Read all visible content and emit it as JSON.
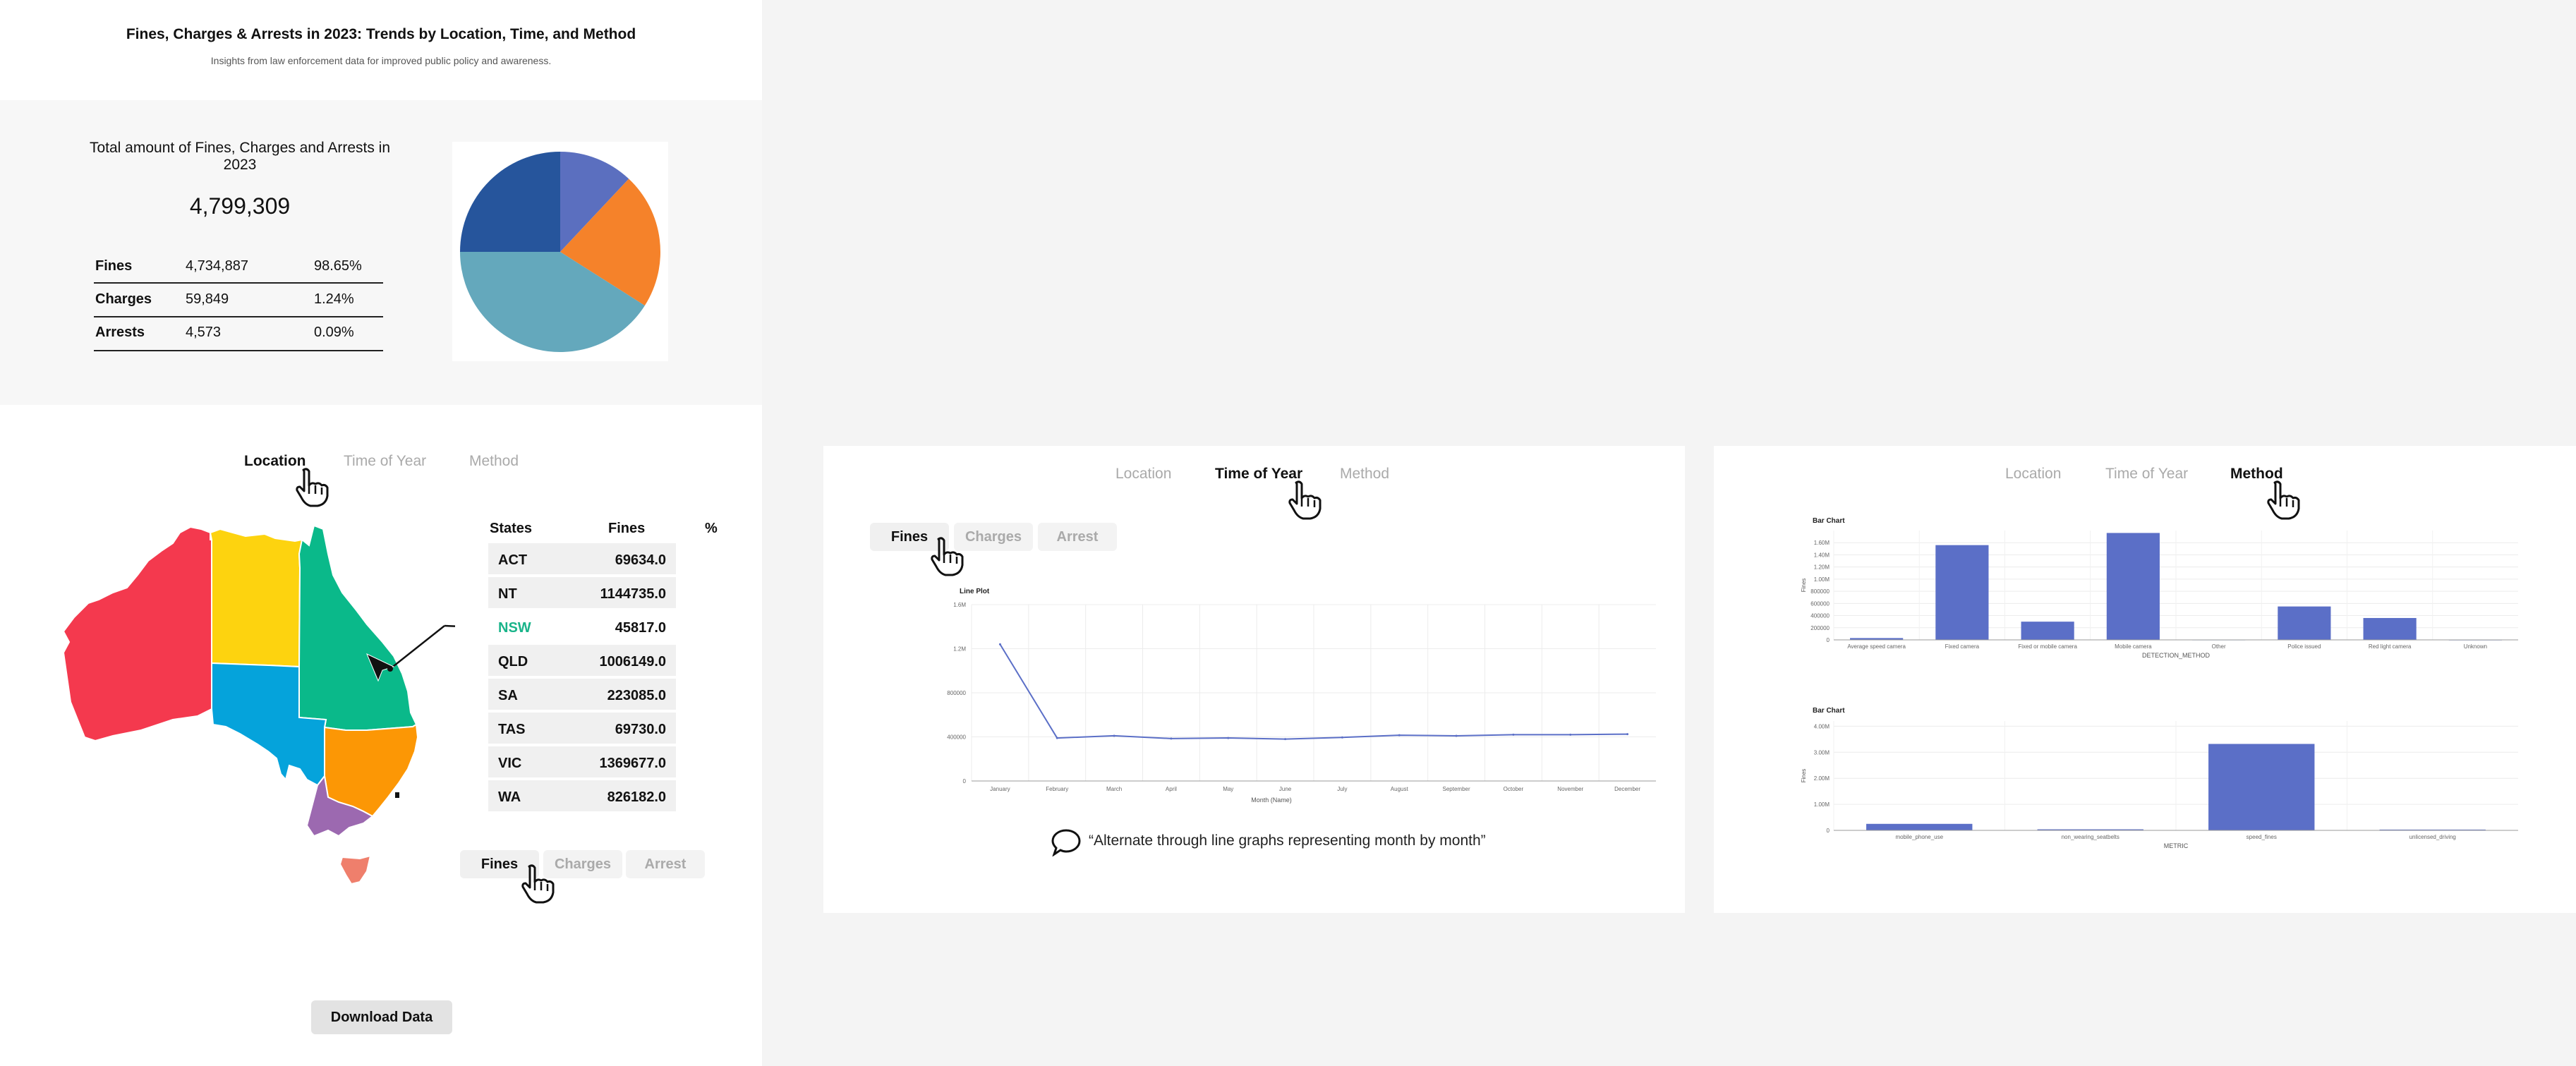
{
  "header": {
    "title": "Fines, Charges & Arrests in 2023: Trends by Location, Time, and Method",
    "subtitle": "Insights from law enforcement data for improved public policy and awareness."
  },
  "summary": {
    "title": "Total amount of Fines, Charges and Arrests in 2023",
    "total": "4,799,309",
    "breakdown": [
      {
        "label": "Fines",
        "value": "4,734,887",
        "pct": "98.65%"
      },
      {
        "label": "Charges",
        "value": "59,849",
        "pct": "1.24%"
      },
      {
        "label": "Arrests",
        "value": "4,573",
        "pct": "0.09%"
      }
    ]
  },
  "pie_chart": {
    "type": "pie",
    "slices": [
      {
        "value": 12,
        "color": "#5b6fbf"
      },
      {
        "value": 22,
        "color": "#f5822a"
      },
      {
        "value": 41,
        "color": "#64a8bc"
      },
      {
        "value": 25,
        "color": "#26559c"
      }
    ]
  },
  "tabs": {
    "location": "Location",
    "time": "Time of Year",
    "method": "Method"
  },
  "subtabs": {
    "fines": "Fines",
    "charges": "Charges",
    "arrest": "Arrest"
  },
  "states_table": {
    "headers": {
      "state": "States",
      "fines": "Fines",
      "pct": "%"
    },
    "rows": [
      {
        "state": "ACT",
        "fines": "69634.0"
      },
      {
        "state": "NT",
        "fines": "1144735.0"
      },
      {
        "state": "NSW",
        "fines": "45817.0"
      },
      {
        "state": "QLD",
        "fines": "1006149.0"
      },
      {
        "state": "SA",
        "fines": "223085.0"
      },
      {
        "state": "TAS",
        "fines": "69730.0"
      },
      {
        "state": "VIC",
        "fines": "1369677.0"
      },
      {
        "state": "WA",
        "fines": "826182.0"
      }
    ]
  },
  "map_colors": {
    "WA": "#f4394e",
    "NT": "#fdd30f",
    "QLD": "#0ab98a",
    "SA": "#05a3db",
    "NSW": "#fc9705",
    "VIC": "#9c69b0",
    "TAS": "#ef7f6c"
  },
  "download_label": "Download Data",
  "quote": "“Alternate through line graphs representing month by month”",
  "chart_data": [
    {
      "type": "line",
      "title": "Line Plot",
      "xlabel": "Month (Name)",
      "ylabel": "",
      "categories": [
        "January",
        "February",
        "March",
        "April",
        "May",
        "June",
        "July",
        "August",
        "September",
        "October",
        "November",
        "December"
      ],
      "values": [
        1240000,
        390000,
        410000,
        385000,
        390000,
        380000,
        395000,
        415000,
        410000,
        420000,
        420000,
        425000
      ],
      "ylim": [
        0,
        1300000
      ],
      "yticks": [
        "0",
        "400000",
        "800000",
        "1.2M",
        "1.6M"
      ],
      "color": "#5b6fc7"
    },
    {
      "type": "bar",
      "title": "Bar Chart",
      "xlabel": "DETECTION_METHOD",
      "ylabel": "Fines",
      "categories": [
        "Average speed camera",
        "Fixed camera",
        "Fixed or mobile camera",
        "Mobile camera",
        "Other",
        "Police issued",
        "Red light camera",
        "Unknown"
      ],
      "values": [
        30000,
        1560000,
        300000,
        1760000,
        5000,
        550000,
        360000,
        4000
      ],
      "ylim": [
        0,
        1800000
      ],
      "yticks": [
        "0",
        "200000",
        "400000",
        "600000",
        "800000",
        "1.00M",
        "1.20M",
        "1.40M",
        "1.60M"
      ],
      "color": "#5b6fc7"
    },
    {
      "type": "bar",
      "title": "Bar Chart",
      "xlabel": "METRIC",
      "ylabel": "Fines",
      "categories": [
        "mobile_phone_use",
        "non_wearing_seatbelts",
        "speed_fines",
        "unlicensed_driving"
      ],
      "values": [
        250000,
        40000,
        3320000,
        30000
      ],
      "ylim": [
        0,
        3600000
      ],
      "yticks": [
        "0",
        "1.00M",
        "2.00M",
        "3.00M",
        "4.00M"
      ],
      "color": "#5b6fc7"
    }
  ]
}
